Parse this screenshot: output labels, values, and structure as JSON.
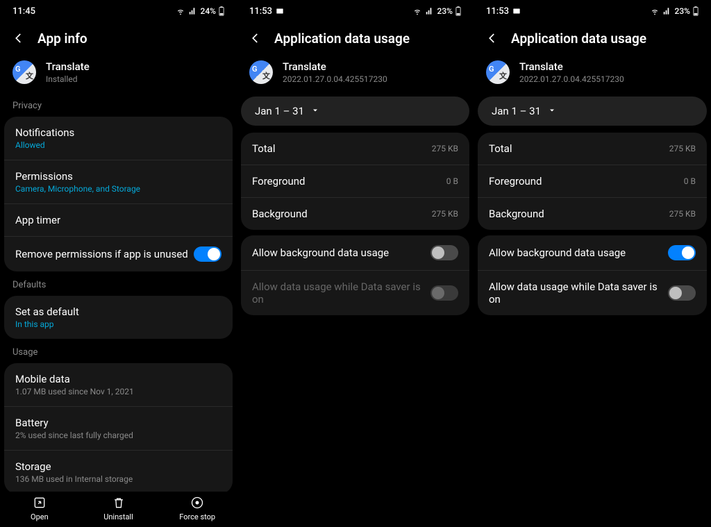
{
  "panel1": {
    "status": {
      "time": "11:45",
      "battery": "24%"
    },
    "header": "App info",
    "app": {
      "name": "Translate",
      "sub": "Installed"
    },
    "privacy_label": "Privacy",
    "notifications": {
      "title": "Notifications",
      "sub": "Allowed"
    },
    "permissions": {
      "title": "Permissions",
      "sub": "Camera, Microphone, and Storage"
    },
    "apptimer": {
      "title": "App timer"
    },
    "remove_perms": {
      "title": "Remove permissions if app is unused"
    },
    "defaults_label": "Defaults",
    "set_default": {
      "title": "Set as default",
      "sub": "In this app"
    },
    "usage_label": "Usage",
    "mobile_data": {
      "title": "Mobile data",
      "sub": "1.07 MB used since Nov 1, 2021"
    },
    "battery": {
      "title": "Battery",
      "sub": "2% used since last fully charged"
    },
    "storage": {
      "title": "Storage",
      "sub": "136 MB used in Internal storage"
    },
    "bottom": {
      "open": "Open",
      "uninstall": "Uninstall",
      "forcestop": "Force stop"
    }
  },
  "panel2": {
    "status": {
      "time": "11:53",
      "battery": "23%"
    },
    "header": "Application data usage",
    "app": {
      "name": "Translate",
      "sub": "2022.01.27.0.04.425517230"
    },
    "date_range": "Jan 1 – 31",
    "total": {
      "label": "Total",
      "value": "275 KB"
    },
    "foreground": {
      "label": "Foreground",
      "value": "0 B"
    },
    "background": {
      "label": "Background",
      "value": "275 KB"
    },
    "allow_bg": "Allow background data usage",
    "allow_ds": "Allow data usage while Data saver is on"
  },
  "panel3": {
    "status": {
      "time": "11:53",
      "battery": "23%"
    },
    "header": "Application data usage",
    "app": {
      "name": "Translate",
      "sub": "2022.01.27.0.04.425517230"
    },
    "date_range": "Jan 1 – 31",
    "total": {
      "label": "Total",
      "value": "275 KB"
    },
    "foreground": {
      "label": "Foreground",
      "value": "0 B"
    },
    "background": {
      "label": "Background",
      "value": "275 KB"
    },
    "allow_bg": "Allow background data usage",
    "allow_ds": "Allow data usage while Data saver is on"
  }
}
